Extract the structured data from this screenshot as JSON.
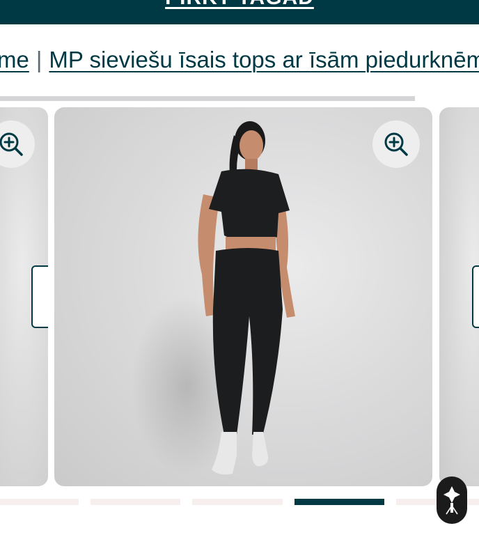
{
  "colors": {
    "brand": "#003944"
  },
  "topbar": {
    "label": "PIRKT TAGAD"
  },
  "breadcrumb": {
    "prev_label": "me",
    "separator": "|",
    "current_label": "MP sieviešu īsais tops ar īsām piedurknēm"
  },
  "gallery": {
    "zoom_icon": "zoom-in-icon",
    "image_description": "product-photo",
    "slide_count": 5,
    "active_slide": 4
  },
  "badge": {
    "icon": "brand-logo-icon"
  }
}
